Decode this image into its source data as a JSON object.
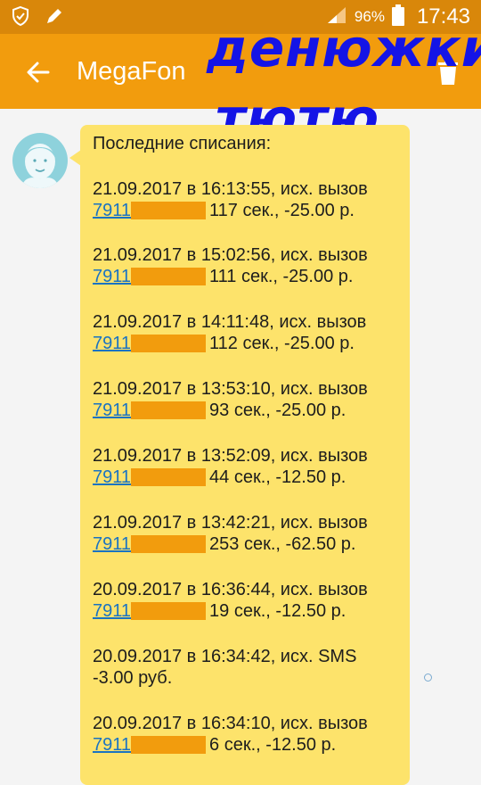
{
  "status_bar": {
    "battery_percent": "96%",
    "time": "17:43",
    "icons": [
      "shield-icon",
      "pencil-icon",
      "signal-icon",
      "battery-icon"
    ]
  },
  "app_bar": {
    "title": "MegaFon",
    "icons": [
      "back-arrow-icon",
      "trash-icon"
    ]
  },
  "overlay_text": {
    "line1": "денюжки",
    "line2": "тютю"
  },
  "message": {
    "header": "Последние списания:",
    "entries": [
      {
        "datetime": "21.09.2017 в 16:13:55, исх. вызов",
        "number": "7911",
        "details": "117 сек., -25.00 р."
      },
      {
        "datetime": "21.09.2017 в 15:02:56, исх. вызов",
        "number": "7911",
        "details": "111 сек., -25.00 р."
      },
      {
        "datetime": "21.09.2017 в 14:11:48, исх. вызов",
        "number": "7911",
        "details": "112 сек., -25.00 р."
      },
      {
        "datetime": "21.09.2017 в 13:53:10, исх. вызов",
        "number": "7911",
        "details": "93 сек., -25.00 р."
      },
      {
        "datetime": "21.09.2017 в 13:52:09, исх. вызов",
        "number": "7911",
        "details": "44 сек., -12.50 р."
      },
      {
        "datetime": "21.09.2017 в 13:42:21, исх. вызов",
        "number": "7911",
        "details": "253 сек., -62.50 р."
      },
      {
        "datetime": "20.09.2017 в 16:36:44, исх. вызов",
        "number": "7911",
        "details": "19 сек., -12.50 р."
      },
      {
        "datetime": "20.09.2017 в 16:34:42, исх. SMS",
        "number": "",
        "details": "-3.00 руб."
      },
      {
        "datetime": "20.09.2017 в 16:34:10, исх. вызов",
        "number": "7911",
        "details": "6 сек., -12.50 р."
      }
    ]
  },
  "colors": {
    "status_bar": "#d9870a",
    "app_bar": "#f29c0d",
    "bubble": "#fde36b",
    "link": "#1a73c2",
    "overlay_text": "#1414e6"
  }
}
